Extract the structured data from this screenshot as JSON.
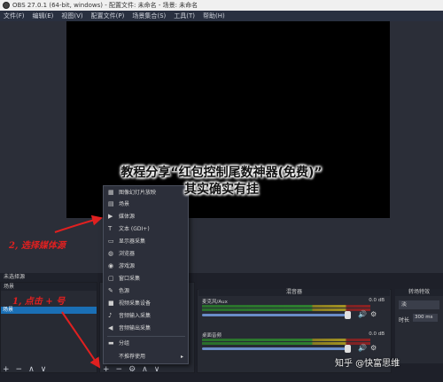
{
  "window": {
    "title": "OBS 27.0.1 (64-bit, windows) - 配置文件: 未命名 - 场景: 未命名"
  },
  "menubar": {
    "items": [
      "文件(F)",
      "编辑(E)",
      "视图(V)",
      "配置文件(P)",
      "场景集合(S)",
      "工具(T)",
      "帮助(H)"
    ]
  },
  "overlay": {
    "title_line1": "教程分享“红包控制尾数神器(免费)”",
    "title_line2": "其实确实有挂"
  },
  "annotations": {
    "step2": "2, 选择媒体源",
    "step1": "1, 点击 + 号"
  },
  "context_menu": {
    "items": [
      {
        "label": "图像幻灯片放映",
        "icon": "slideshow-icon"
      },
      {
        "label": "场景",
        "icon": "scene-icon"
      },
      {
        "label": "媒体源",
        "icon": "play-icon"
      },
      {
        "label": "文本 (GDI+)",
        "icon": "text-icon"
      },
      {
        "label": "显示器采集",
        "icon": "monitor-icon"
      },
      {
        "label": "浏览器",
        "icon": "globe-icon"
      },
      {
        "label": "游戏源",
        "icon": "gamepad-icon"
      },
      {
        "label": "窗口采集",
        "icon": "window-icon"
      },
      {
        "label": "色源",
        "icon": "brush-icon"
      },
      {
        "label": "视频采集设备",
        "icon": "camera-icon"
      },
      {
        "label": "音频输入采集",
        "icon": "microphone-icon"
      },
      {
        "label": "音频输出采集",
        "icon": "speaker-icon"
      },
      {
        "label": "分组",
        "icon": "folder-icon"
      },
      {
        "label": "不推荐使用",
        "icon": "chevron-right-icon"
      }
    ]
  },
  "scenes": {
    "header": "未选择源",
    "dock_title": "场景",
    "items": [
      "场景"
    ]
  },
  "mixer": {
    "title": "混音器",
    "channels": [
      {
        "name": "麦克风/Aux",
        "db": "0.0 dB",
        "level": 1.0
      },
      {
        "name": "桌面音频",
        "db": "0.0 dB",
        "level": 1.0
      }
    ]
  },
  "transitions": {
    "title": "转场特效",
    "selected": "淡",
    "duration_label": "时长",
    "duration_value": "300 ms"
  },
  "toolbar": {
    "add": "+",
    "remove": "−",
    "up": "∧",
    "down": "∨",
    "settings": "⚙"
  },
  "watermark": "知乎 @快富思维"
}
